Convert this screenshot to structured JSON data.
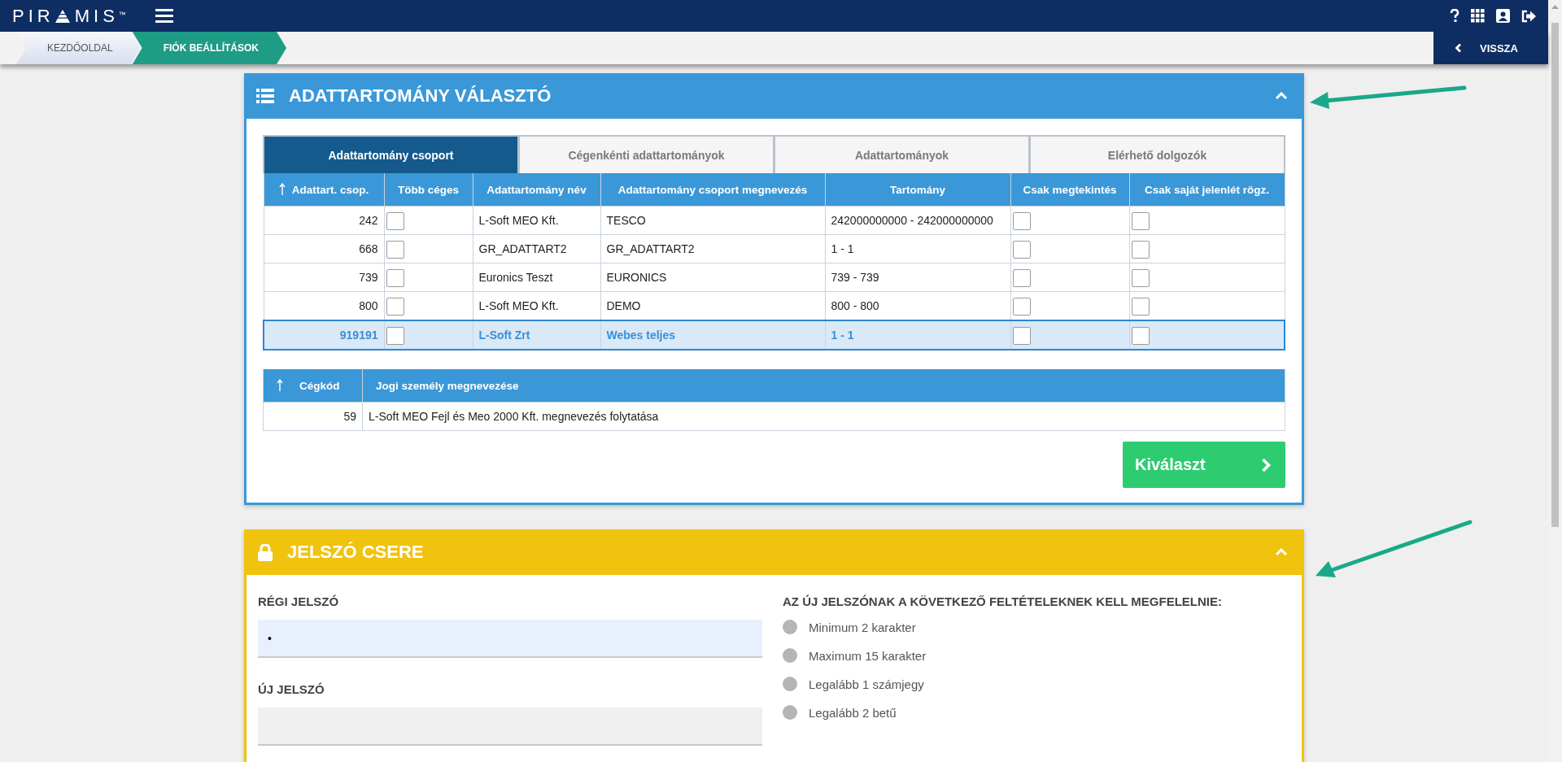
{
  "topbar": {
    "logo_left": "PIR",
    "logo_right": "MIS",
    "logo_mark": "™",
    "icons": [
      {
        "kind": "help"
      },
      {
        "kind": "apps"
      },
      {
        "kind": "profile"
      },
      {
        "kind": "logout"
      }
    ]
  },
  "breadcrumbs": [
    {
      "label": "KEZDŐOLDAL",
      "selected": false
    },
    {
      "label": "FIÓK BEÁLLÍTÁSOK",
      "selected": true
    }
  ],
  "back_button": {
    "label": "VISSZA"
  },
  "domain_panel": {
    "title": "ADATTARTOMÁNY VÁLASZTÓ",
    "expanded": true,
    "tabs": [
      {
        "label": "Adattartomány csoport",
        "selected": true
      },
      {
        "label": "Cégenkénti adattartományok",
        "selected": false
      },
      {
        "label": "Adattartományok",
        "selected": false
      },
      {
        "label": "Elérhető dolgozók",
        "selected": false
      }
    ],
    "table": {
      "columns": [
        {
          "label": "Adattart. csop.",
          "sorted": true
        },
        {
          "label": "Több céges",
          "sorted": false
        },
        {
          "label": "Adattartomány név",
          "sorted": false
        },
        {
          "label": "Adattartomány csoport megnevezés",
          "sorted": false
        },
        {
          "label": "Tartomány",
          "sorted": false
        },
        {
          "label": "Csak megtekintés",
          "sorted": false
        },
        {
          "label": "Csak saját jelenlét rögz.",
          "sorted": false
        }
      ],
      "rows": [
        {
          "code": "242",
          "multi_company": false,
          "name": "L-Soft MEO Kft.",
          "group_name": "TESCO",
          "range": "242000000000 - 242000000000",
          "view_only": false,
          "own_only": false,
          "selected": false
        },
        {
          "code": "668",
          "multi_company": false,
          "name": "GR_ADATTART2",
          "group_name": "GR_ADATTART2",
          "range": "1 - 1",
          "view_only": false,
          "own_only": false,
          "selected": false
        },
        {
          "code": "739",
          "multi_company": false,
          "name": "Euronics Teszt",
          "group_name": "EURONICS",
          "range": "739 - 739",
          "view_only": false,
          "own_only": false,
          "selected": false
        },
        {
          "code": "800",
          "multi_company": false,
          "name": "L-Soft MEO Kft.",
          "group_name": "DEMO",
          "range": "800 - 800",
          "view_only": false,
          "own_only": false,
          "selected": false
        },
        {
          "code": "919191",
          "multi_company": false,
          "name": "L-Soft Zrt",
          "group_name": "Webes teljes",
          "range": "1 - 1",
          "view_only": false,
          "own_only": false,
          "selected": true
        }
      ]
    },
    "company_table": {
      "columns": [
        {
          "label": "Cégkód",
          "sorted": true
        },
        {
          "label": "Jogi személy megnevezése",
          "sorted": false
        }
      ],
      "rows": [
        {
          "code": "59",
          "name": "L-Soft MEO Fejl és Meo 2000 Kft. megnevezés folytatása"
        }
      ]
    },
    "select_button": {
      "label": "Kiválaszt"
    }
  },
  "password_panel": {
    "title": "JELSZÓ CSERE",
    "expanded": true,
    "fields": [
      {
        "label": "RÉGI JELSZÓ",
        "value": "•"
      },
      {
        "label": "ÚJ JELSZÓ"
      }
    ],
    "rules_title": "AZ ÚJ JELSZÓNAK A KÖVETKEZŐ FELTÉTELEKNEK KELL MEGFELELNIE:",
    "rules": [
      {
        "label": "Minimum 2 karakter",
        "met": false
      },
      {
        "label": "Maximum 15 karakter",
        "met": false
      },
      {
        "label": "Legalább 1 számjegy",
        "met": false
      },
      {
        "label": "Legalább 2 betű",
        "met": false
      }
    ]
  }
}
